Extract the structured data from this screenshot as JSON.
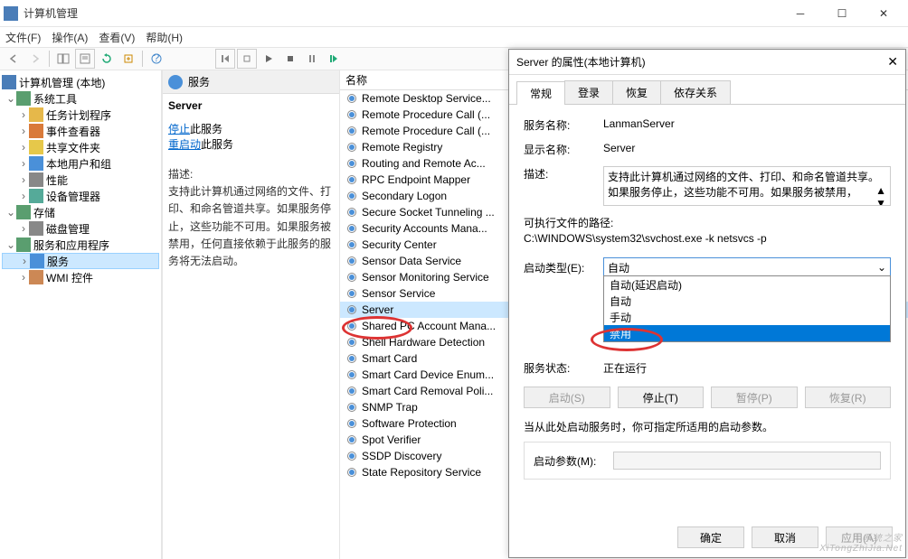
{
  "window": {
    "title": "计算机管理",
    "menus": [
      "文件(F)",
      "操作(A)",
      "查看(V)",
      "帮助(H)"
    ]
  },
  "tree": {
    "root": "计算机管理 (本地)",
    "groups": [
      {
        "label": "系统工具",
        "expanded": true,
        "children": [
          {
            "label": "任务计划程序",
            "icon": "clock"
          },
          {
            "label": "事件查看器",
            "icon": "event"
          },
          {
            "label": "共享文件夹",
            "icon": "folder"
          },
          {
            "label": "本地用户和组",
            "icon": "users"
          },
          {
            "label": "性能",
            "icon": "perf"
          },
          {
            "label": "设备管理器",
            "icon": "device"
          }
        ]
      },
      {
        "label": "存储",
        "expanded": true,
        "children": [
          {
            "label": "磁盘管理",
            "icon": "disk"
          }
        ]
      },
      {
        "label": "服务和应用程序",
        "expanded": true,
        "children": [
          {
            "label": "服务",
            "icon": "gear",
            "selected": true
          },
          {
            "label": "WMI 控件",
            "icon": "wmi"
          }
        ]
      }
    ]
  },
  "middle": {
    "header": "服务",
    "selected": "Server",
    "stop_text": "停止",
    "restart_text": "重启动",
    "suffix": "此服务",
    "desc_label": "描述:",
    "desc": "支持此计算机通过网络的文件、打印、和命名管道共享。如果服务停止，这些功能不可用。如果服务被禁用，任何直接依赖于此服务的服务将无法启动。"
  },
  "list": {
    "header": "名称",
    "items": [
      "Remote Desktop Service...",
      "Remote Procedure Call (...",
      "Remote Procedure Call (...",
      "Remote Registry",
      "Routing and Remote Ac...",
      "RPC Endpoint Mapper",
      "Secondary Logon",
      "Secure Socket Tunneling ...",
      "Security Accounts Mana...",
      "Security Center",
      "Sensor Data Service",
      "Sensor Monitoring Service",
      "Sensor Service",
      "Server",
      "Shared PC Account Mana...",
      "Shell Hardware Detection",
      "Smart Card",
      "Smart Card Device Enum...",
      "Smart Card Removal Poli...",
      "SNMP Trap",
      "Software Protection",
      "Spot Verifier",
      "SSDP Discovery",
      "State Repository Service"
    ],
    "selected_index": 13
  },
  "dialog": {
    "title": "Server 的属性(本地计算机)",
    "tabs": [
      "常规",
      "登录",
      "恢复",
      "依存关系"
    ],
    "active_tab": 0,
    "svc_name_lbl": "服务名称:",
    "svc_name": "LanmanServer",
    "disp_name_lbl": "显示名称:",
    "disp_name": "Server",
    "desc_lbl": "描述:",
    "desc": "支持此计算机通过网络的文件、打印、和命名管道共享。如果服务停止，这些功能不可用。如果服务被禁用，",
    "exe_lbl": "可执行文件的路径:",
    "exe": "C:\\WINDOWS\\system32\\svchost.exe -k netsvcs -p",
    "start_type_lbl": "启动类型(E):",
    "start_type": "自动",
    "options": [
      "自动(延迟启动)",
      "自动",
      "手动",
      "禁用"
    ],
    "highlight_index": 3,
    "status_lbl": "服务状态:",
    "status": "正在运行",
    "btn_start": "启动(S)",
    "btn_stop": "停止(T)",
    "btn_pause": "暂停(P)",
    "btn_resume": "恢复(R)",
    "hint": "当从此处启动服务时，你可指定所适用的启动参数。",
    "param_lbl": "启动参数(M):",
    "ok": "确定",
    "cancel": "取消",
    "apply": "应用(A)"
  },
  "watermark": "系统之家\nXiTongZhiJia.Net"
}
